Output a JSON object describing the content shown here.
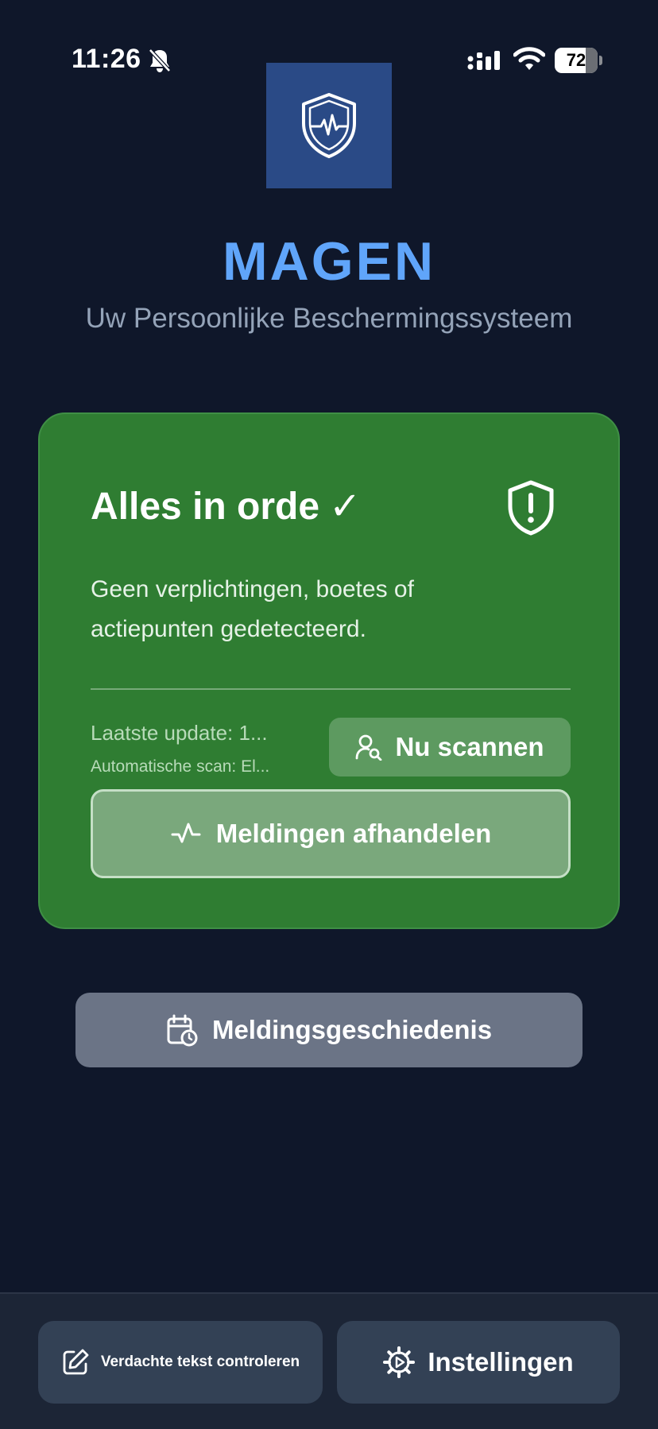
{
  "status_bar": {
    "time": "11:26",
    "battery": "72",
    "battery_level": 0.72,
    "icons": [
      "bell-off-icon",
      "signal-icon",
      "wifi-icon",
      "battery-icon"
    ]
  },
  "header": {
    "logo_icon": "shield-heartbeat-icon",
    "title": "MAGEN",
    "subtitle": "Uw Persoonlijke Beschermingssysteem"
  },
  "status_card": {
    "title": "Alles in orde",
    "check": "✓",
    "alert_icon": "shield-alert-icon",
    "description": "Geen verplichtingen, boetes of actiepunten gedetecteerd.",
    "last_update": "Laatste update: 1...",
    "auto_scan": "Automatische scan: El...",
    "scan_button": {
      "label": "Nu scannen",
      "icon": "user-search-icon"
    },
    "handle_button": {
      "label": "Meldingen afhandelen",
      "icon": "activity-icon"
    },
    "colors": {
      "background": "#2f7d32"
    }
  },
  "history_button": {
    "label": "Meldingsgeschiedenis",
    "icon": "calendar-clock-icon"
  },
  "bottom_bar": {
    "verify_button": {
      "label": "Verdachte tekst controleren",
      "icon": "edit-icon"
    },
    "settings_button": {
      "label": "Instellingen",
      "icon": "gear-icon"
    }
  },
  "colors": {
    "background": "#0f172a",
    "accent": "#60a5fa",
    "subtitle": "#94a3b8"
  }
}
